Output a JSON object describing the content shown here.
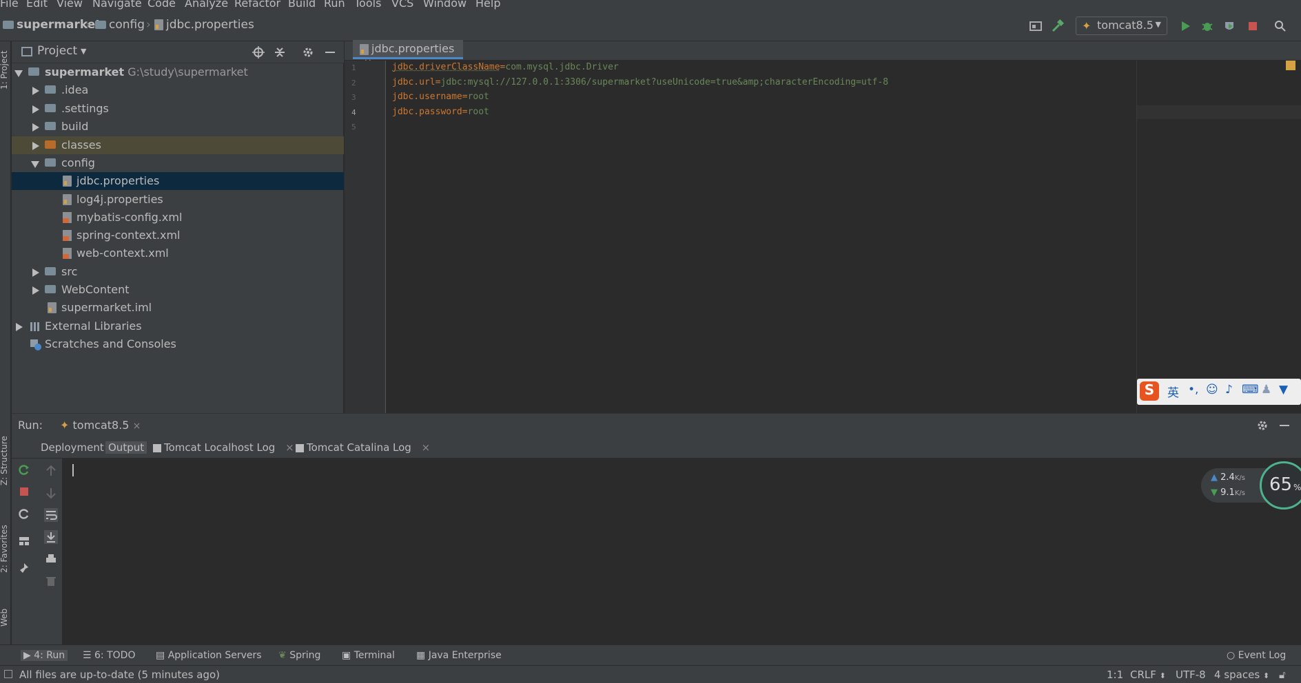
{
  "menu": [
    "File",
    "Edit",
    "View",
    "Navigate",
    "Code",
    "Analyze",
    "Refactor",
    "Build",
    "Run",
    "Tools",
    "VCS",
    "Window",
    "Help"
  ],
  "breadcrumb": [
    "supermarket",
    "config",
    "jdbc.properties"
  ],
  "run_config": "tomcat8.5",
  "left_stripe": [
    "1: Project",
    "Z: Structure",
    "2: Favorites",
    "Web"
  ],
  "project_panel": {
    "title": "Project",
    "tree": [
      {
        "label": "supermarket",
        "path": "G:\\study\\supermarket",
        "indent": 0,
        "expanded": true,
        "icon": "folder-icon"
      },
      {
        "label": ".idea",
        "indent": 1,
        "expanded": false,
        "icon": "folder-icon"
      },
      {
        "label": ".settings",
        "indent": 1,
        "expanded": false,
        "icon": "folder-icon"
      },
      {
        "label": "build",
        "indent": 1,
        "expanded": false,
        "icon": "folder-icon"
      },
      {
        "label": "classes",
        "indent": 1,
        "expanded": false,
        "icon": "excluded-folder-icon"
      },
      {
        "label": "config",
        "indent": 1,
        "expanded": true,
        "icon": "folder-icon"
      },
      {
        "label": "jdbc.properties",
        "indent": 2,
        "icon": "properties-file-icon",
        "selected": true
      },
      {
        "label": "log4j.properties",
        "indent": 2,
        "icon": "properties-file-icon"
      },
      {
        "label": "mybatis-config.xml",
        "indent": 2,
        "icon": "xml-file-icon"
      },
      {
        "label": "spring-context.xml",
        "indent": 2,
        "icon": "spring-xml-file-icon"
      },
      {
        "label": "web-context.xml",
        "indent": 2,
        "icon": "spring-xml-file-icon"
      },
      {
        "label": "src",
        "indent": 1,
        "expanded": false,
        "icon": "folder-icon"
      },
      {
        "label": "WebContent",
        "indent": 1,
        "expanded": false,
        "icon": "web-folder-icon"
      },
      {
        "label": "supermarket.iml",
        "indent": 1,
        "icon": "iml-file-icon"
      },
      {
        "label": "External Libraries",
        "indent": 0,
        "expanded": false,
        "icon": "libraries-icon"
      },
      {
        "label": "Scratches and Consoles",
        "indent": 0,
        "icon": "scratches-icon"
      }
    ]
  },
  "editor": {
    "tab": "jdbc.properties",
    "lines": [
      {
        "n": "1",
        "key": "jdbc.driverClassName",
        "value": "com.mysql.jdbc.Driver"
      },
      {
        "n": "2",
        "key": "jdbc.url",
        "value": "jdbc:mysql://127.0.0.1:3306/supermarket?useUnicode=true&amp;characterEncoding=utf-8"
      },
      {
        "n": "3",
        "key": "jdbc.username",
        "value": "root"
      },
      {
        "n": "4",
        "key": "jdbc.password",
        "value": "root"
      },
      {
        "n": "5",
        "key": "",
        "value": ""
      }
    ]
  },
  "run_window": {
    "label": "Run:",
    "config_tab": "tomcat8.5",
    "tabs": [
      "Deployment",
      "Output",
      "Tomcat Localhost Log",
      "Tomcat Catalina Log"
    ],
    "active_tab": "Output"
  },
  "bottom_tools": [
    {
      "label": "4: Run",
      "icon": "run-icon"
    },
    {
      "label": "6: TODO",
      "icon": "todo-icon"
    },
    {
      "label": "Application Servers",
      "icon": "server-icon"
    },
    {
      "label": "Spring",
      "icon": "spring-icon"
    },
    {
      "label": "Terminal",
      "icon": "terminal-icon"
    },
    {
      "label": "Java Enterprise",
      "icon": "java-enterprise-icon"
    }
  ],
  "event_log": "Event Log",
  "status": {
    "message": "All files are up-to-date (5 minutes ago)",
    "position": "1:1",
    "line_sep": "CRLF",
    "encoding": "UTF-8",
    "indent": "4 spaces"
  },
  "ime_bar": {
    "mode": "英"
  },
  "net_monitor": {
    "up": "2.4",
    "down": "9.1",
    "unit": "K/s",
    "percent": "65",
    "percent_sign": "%"
  },
  "colors": {
    "keyword": "#cc7832",
    "string": "#6a8759",
    "selection": "#0d293e",
    "accent_green": "#4db38e"
  }
}
